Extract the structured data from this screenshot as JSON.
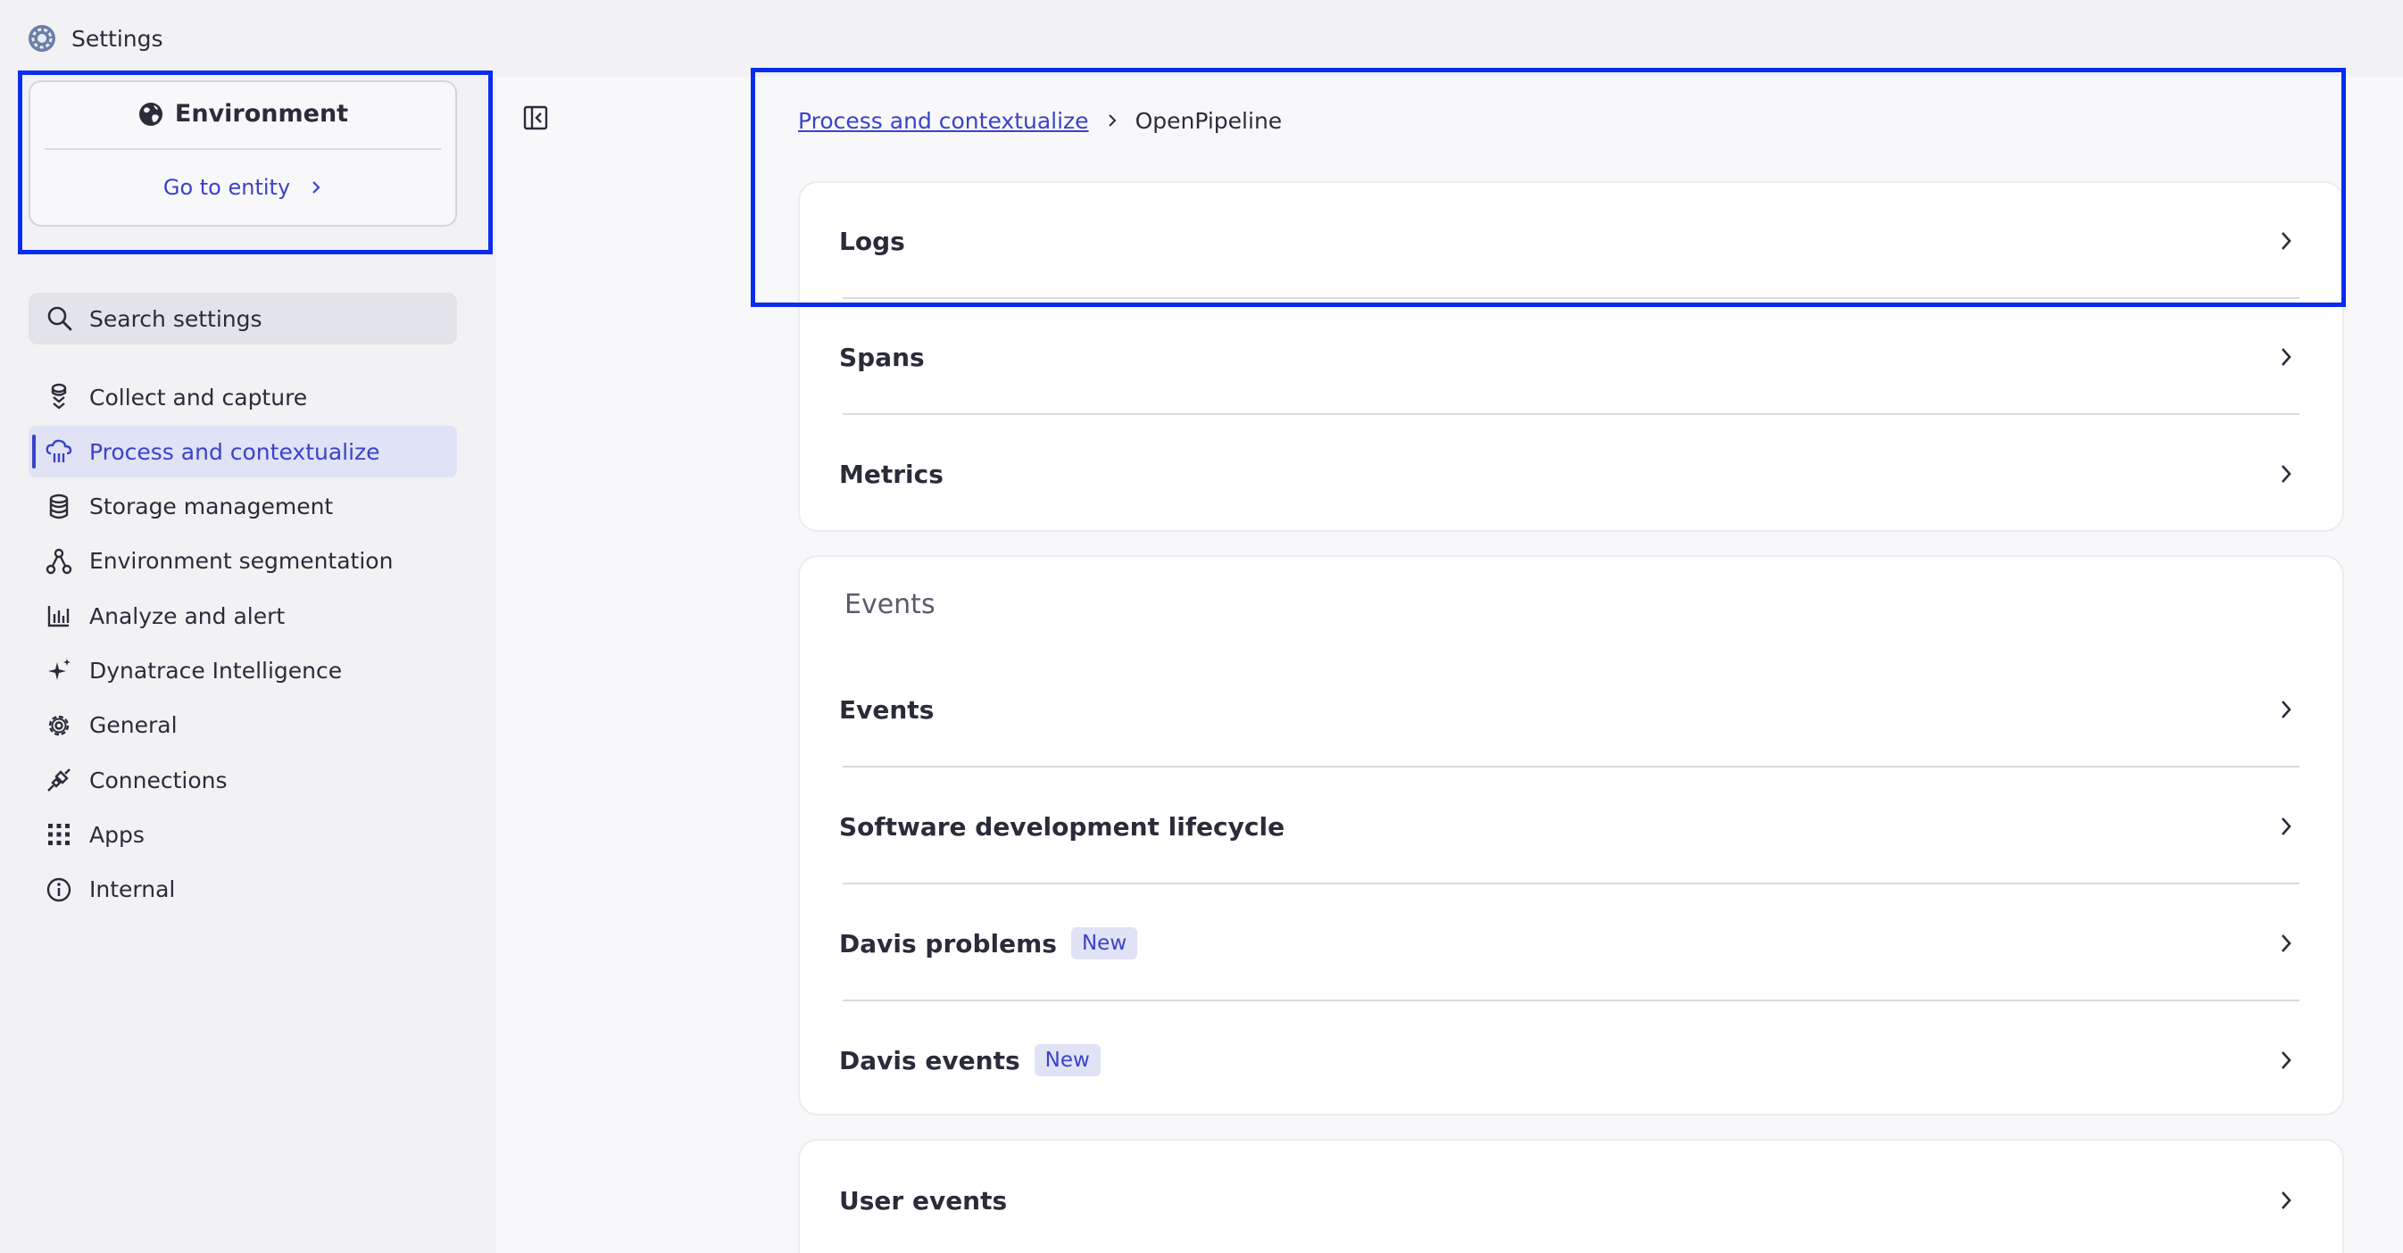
{
  "app": {
    "title": "Settings"
  },
  "environment": {
    "title": "Environment",
    "link_label": "Go to entity"
  },
  "search": {
    "placeholder": "Search settings"
  },
  "nav": {
    "items": [
      {
        "label": "Collect and capture",
        "icon": "collect-icon"
      },
      {
        "label": "Process and contextualize",
        "icon": "process-icon",
        "active": true
      },
      {
        "label": "Storage management",
        "icon": "database-icon"
      },
      {
        "label": "Environment segmentation",
        "icon": "segmentation-icon"
      },
      {
        "label": "Analyze and alert",
        "icon": "chart-icon"
      },
      {
        "label": "Dynatrace Intelligence",
        "icon": "sparkle-icon"
      },
      {
        "label": "General",
        "icon": "gear-icon"
      },
      {
        "label": "Connections",
        "icon": "plug-icon"
      },
      {
        "label": "Apps",
        "icon": "apps-grid-icon"
      },
      {
        "label": "Internal",
        "icon": "info-icon"
      }
    ]
  },
  "breadcrumb": {
    "parent": "Process and contextualize",
    "current": "OpenPipeline"
  },
  "group1": {
    "rows": [
      {
        "label": "Logs"
      },
      {
        "label": "Spans"
      },
      {
        "label": "Metrics"
      }
    ]
  },
  "group2": {
    "title": "Events",
    "rows": [
      {
        "label": "Events"
      },
      {
        "label": "Software development lifecycle"
      },
      {
        "label": "Davis problems",
        "badge": "New"
      },
      {
        "label": "Davis events",
        "badge": "New"
      }
    ]
  },
  "group3": {
    "rows": [
      {
        "label": "User events"
      }
    ]
  },
  "colors": {
    "accent": "#3a43c8",
    "highlight": "#0a2cf0",
    "active_bg": "#e0e2f6"
  }
}
